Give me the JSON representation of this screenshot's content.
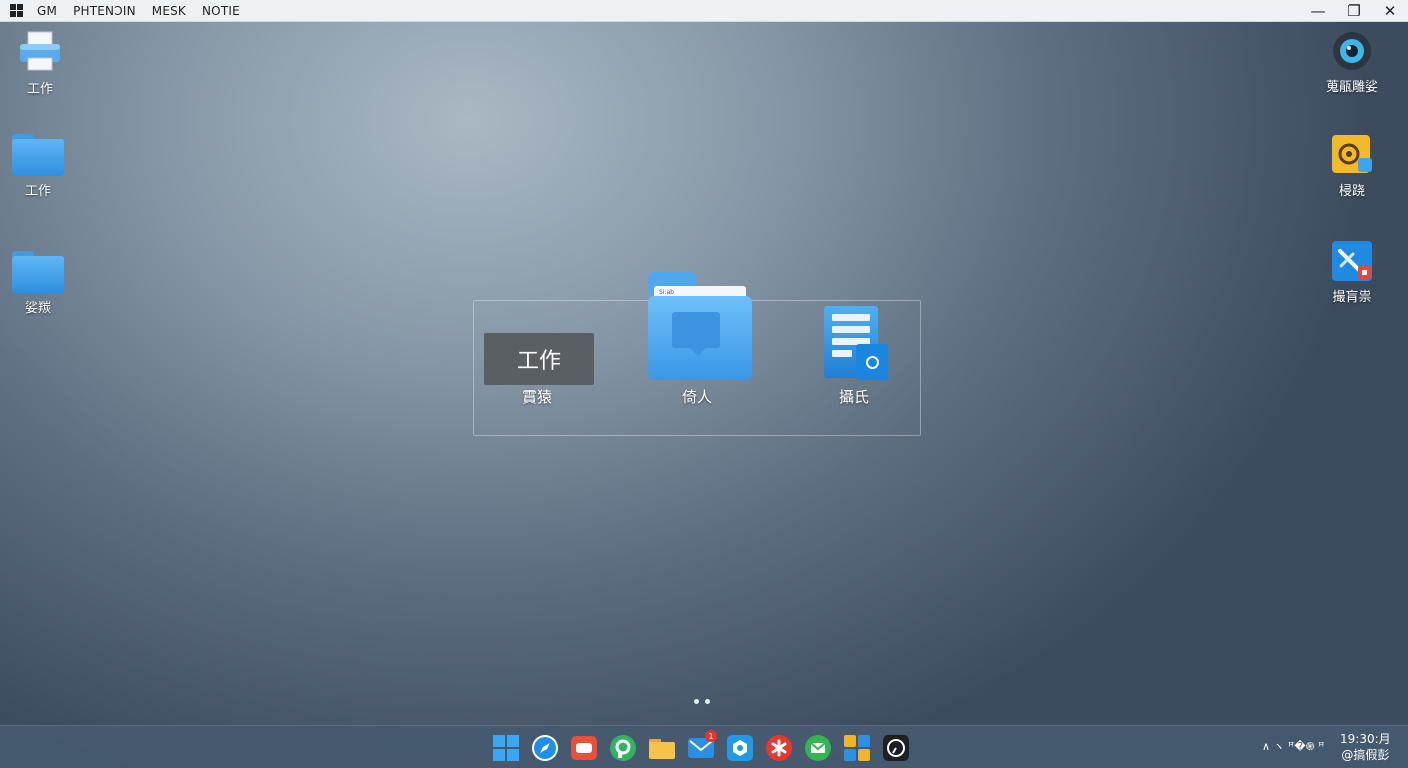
{
  "menubar": {
    "menu_items": [
      "GM",
      "PHTENƆIN",
      "MESK",
      "NOTIE"
    ],
    "minimize_glyph": "—",
    "maximize_glyph": "❐",
    "close_glyph": "✕"
  },
  "desktop_left": [
    {
      "label": "工作",
      "icon": "printer-icon"
    },
    {
      "label": "工作",
      "icon": "folder-icon"
    },
    {
      "label": "娑羰",
      "icon": "folder-icon"
    }
  ],
  "desktop_right": [
    {
      "label": "蒐瓹雕娑",
      "icon": "webcam-icon"
    },
    {
      "label": "梫跷",
      "icon": "audio-settings-icon"
    },
    {
      "label": "撮肓祟",
      "icon": "tools-icon"
    }
  ],
  "group": {
    "tile_title": "工作",
    "labels": [
      "霣猿",
      "倚人",
      "攝氏"
    ],
    "folder_paper_text": "Si:ab"
  },
  "taskbar": {
    "icons": [
      "windows-start-icon",
      "safari-compass-icon",
      "chat-app-icon",
      "messages-icon",
      "file-explorer-icon",
      "mail-icon",
      "store-icon",
      "asterisk-app-icon",
      "green-mail-icon",
      "widgets-icon",
      "clock-app-icon"
    ],
    "mail_badge": "1",
    "tray_text": "∧ ヽ  ꟸ�֍  ꟸ",
    "clock_line1": "19:30:月",
    "clock_line2": "@搞假彭"
  },
  "colors": {
    "accent_blue": "#2f8fe0",
    "menubar_bg": "#eef1f4",
    "taskbar_bg": "#465a70"
  }
}
